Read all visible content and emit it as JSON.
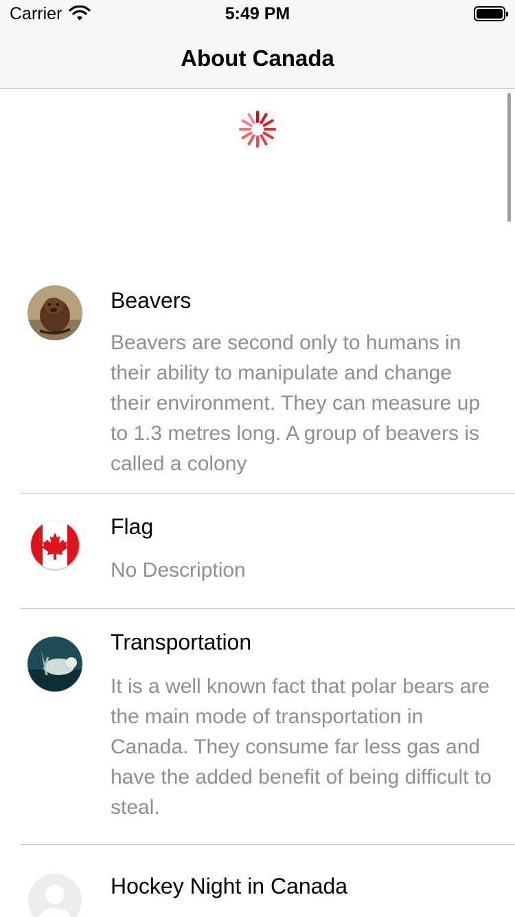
{
  "status_bar": {
    "carrier": "Carrier",
    "time": "5:49 PM"
  },
  "navigation": {
    "title": "About Canada"
  },
  "colors": {
    "spinner": "#e8000b",
    "description_text": "#8e8e93",
    "separator": "#c8c7cc"
  },
  "rows": [
    {
      "title": "Beavers",
      "description": "Beavers are second only to humans in their ability to manipulate and change their environment. They can measure up to 1.3 metres long. A group of beavers is called a colony",
      "icon": "beaver-photo"
    },
    {
      "title": "Flag",
      "description": "No Description",
      "icon": "canada-flag"
    },
    {
      "title": "Transportation",
      "description": "It is a well known fact that polar bears are the main mode of transportation in Canada. They consume far less gas and have the added benefit of being difficult to steal.",
      "icon": "polar-bear-photo"
    },
    {
      "title": "Hockey Night in Canada",
      "description": "",
      "icon": "placeholder-avatar"
    }
  ]
}
